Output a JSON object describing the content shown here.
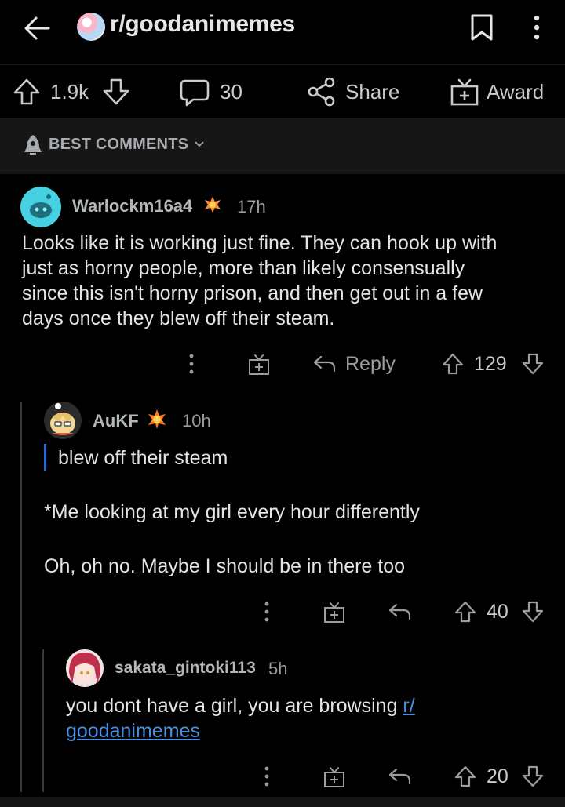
{
  "header": {
    "subreddit": "r/goodanimemes"
  },
  "actions": {
    "votes": "1.9k",
    "comments": "30",
    "share_label": "Share",
    "award_label": "Award"
  },
  "sort": {
    "label": "BEST COMMENTS"
  },
  "comments": [
    {
      "username": "Warlockm16a4",
      "time": "17h",
      "lines": [
        "Looks like it is working just fine. They can hook up with",
        "just as horny people, more than likely consensually",
        "since this isn't horny prison, and then get out in a few",
        "days once they blew off their steam."
      ],
      "reply_label": "Reply",
      "score": "129"
    },
    {
      "username": "AuKF",
      "time": "10h",
      "quote": "blew off their steam",
      "para1": "*Me looking at my girl every hour differently",
      "para2": "Oh, oh no. Maybe I should be in there too",
      "score": "40"
    },
    {
      "username": "sakata_gintoki113",
      "time": "5h",
      "text_before": "you dont have a girl, you are browsing ",
      "link_part1": "r/",
      "link_part2": "goodanimemes",
      "score": "20"
    }
  ],
  "colors": {
    "background": "#000000",
    "link": "#4a8fe0",
    "quote_bar": "#1c6fd6"
  }
}
